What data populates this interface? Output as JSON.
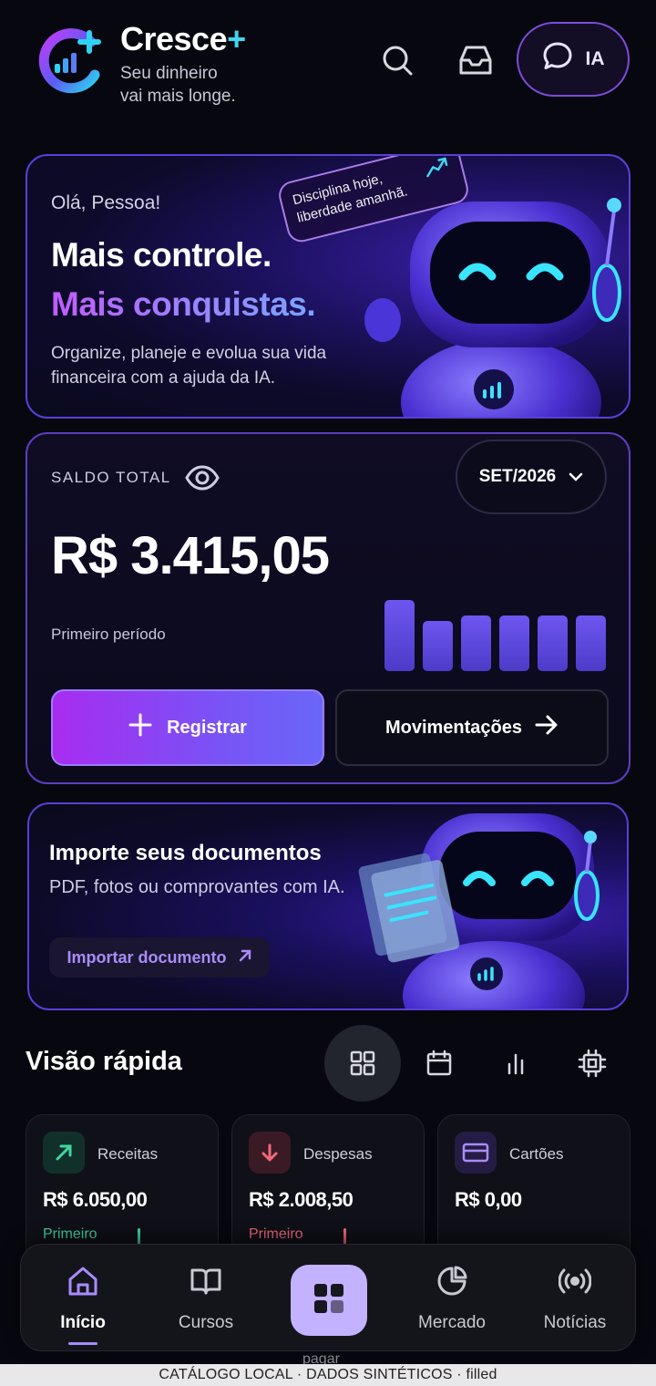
{
  "header": {
    "brand_name": "Cresce",
    "brand_plus": "+",
    "tagline_line1": "Seu dinheiro",
    "tagline_line2": "vai mais longe.",
    "ia_label": "IA",
    "icons": [
      "search-icon",
      "inbox-icon",
      "chat-icon"
    ]
  },
  "hero": {
    "greeting": "Olá, Pessoa!",
    "headline1": "Mais controle.",
    "headline2": "Mais conquistas.",
    "description": "Organize, planeje e evolua sua vida financeira com a ajuda da IA.",
    "bubble_line1": "Disciplina hoje,",
    "bubble_line2": "liberdade amanhã."
  },
  "balance": {
    "label": "SALDO TOTAL",
    "month": "SET/2026",
    "value": "R$ 3.415,05",
    "period": "Primeiro período",
    "bar_levels": [
      1.0,
      0.7,
      0.78,
      0.78,
      0.78,
      0.78
    ],
    "register_label": "Registrar",
    "movements_label": "Movimentações"
  },
  "import_card": {
    "title": "Importe seus documentos",
    "subtitle": "PDF, fotos ou comprovantes com IA.",
    "button_label": "Importar documento"
  },
  "quick_view": {
    "title": "Visão rápida",
    "view_icons": [
      "grid-icon",
      "calendar-icon",
      "bar-chart-icon",
      "chip-icon"
    ],
    "active_view": "grid-icon",
    "cards": [
      {
        "label": "Receitas",
        "value": "R$ 6.050,00",
        "sub": "Primeiro",
        "color": "#3fd6a0"
      },
      {
        "label": "Despesas",
        "value": "R$ 2.008,50",
        "sub": "Primeiro",
        "color": "#f06a7a"
      },
      {
        "label": "Cartões",
        "value": "R$ 0,00",
        "sub": "",
        "color": "#a98cf8"
      }
    ],
    "peek_text": "pagar"
  },
  "nav": {
    "items": [
      {
        "label": "Início",
        "icon": "home-icon",
        "active": true
      },
      {
        "label": "Cursos",
        "icon": "book-icon",
        "active": false
      },
      {
        "label": "",
        "icon": "apps-icon",
        "active": false
      },
      {
        "label": "Mercado",
        "icon": "pie-chart-icon",
        "active": false
      },
      {
        "label": "Notícias",
        "icon": "broadcast-icon",
        "active": false
      }
    ]
  },
  "footer": {
    "text": "CATÁLOGO LOCAL · DADOS SINTÉTICOS · filled"
  },
  "colors": {
    "accent": "#7c4cd8",
    "cyan": "#3fd6f0",
    "income": "#3fd6a0",
    "expense": "#f06a7a"
  }
}
